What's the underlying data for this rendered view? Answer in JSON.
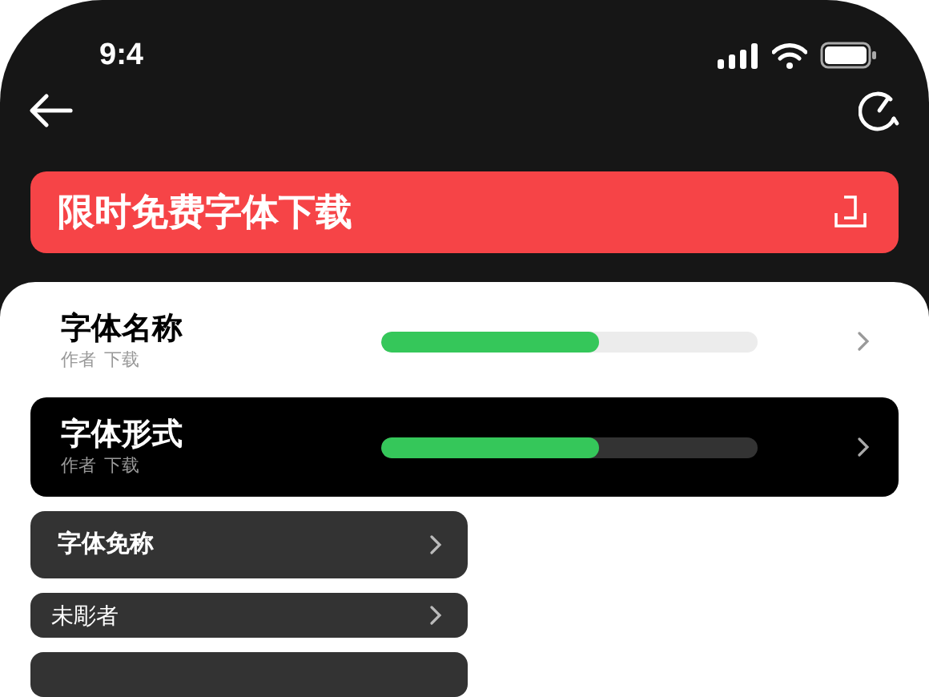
{
  "status_bar": {
    "time": "9:4"
  },
  "banner": {
    "title": "限时免费字体下载"
  },
  "font_rows": [
    {
      "kind": "light",
      "title": "字体名称",
      "author": "作者",
      "download": "下载",
      "level": 0.58
    },
    {
      "kind": "dark",
      "title": "字体形式",
      "author": "作者",
      "download": "下载",
      "level": 0.58
    }
  ],
  "menu_items": [
    {
      "kind": "large",
      "label": "字体免称"
    },
    {
      "kind": "small",
      "label": "未彫者"
    }
  ]
}
